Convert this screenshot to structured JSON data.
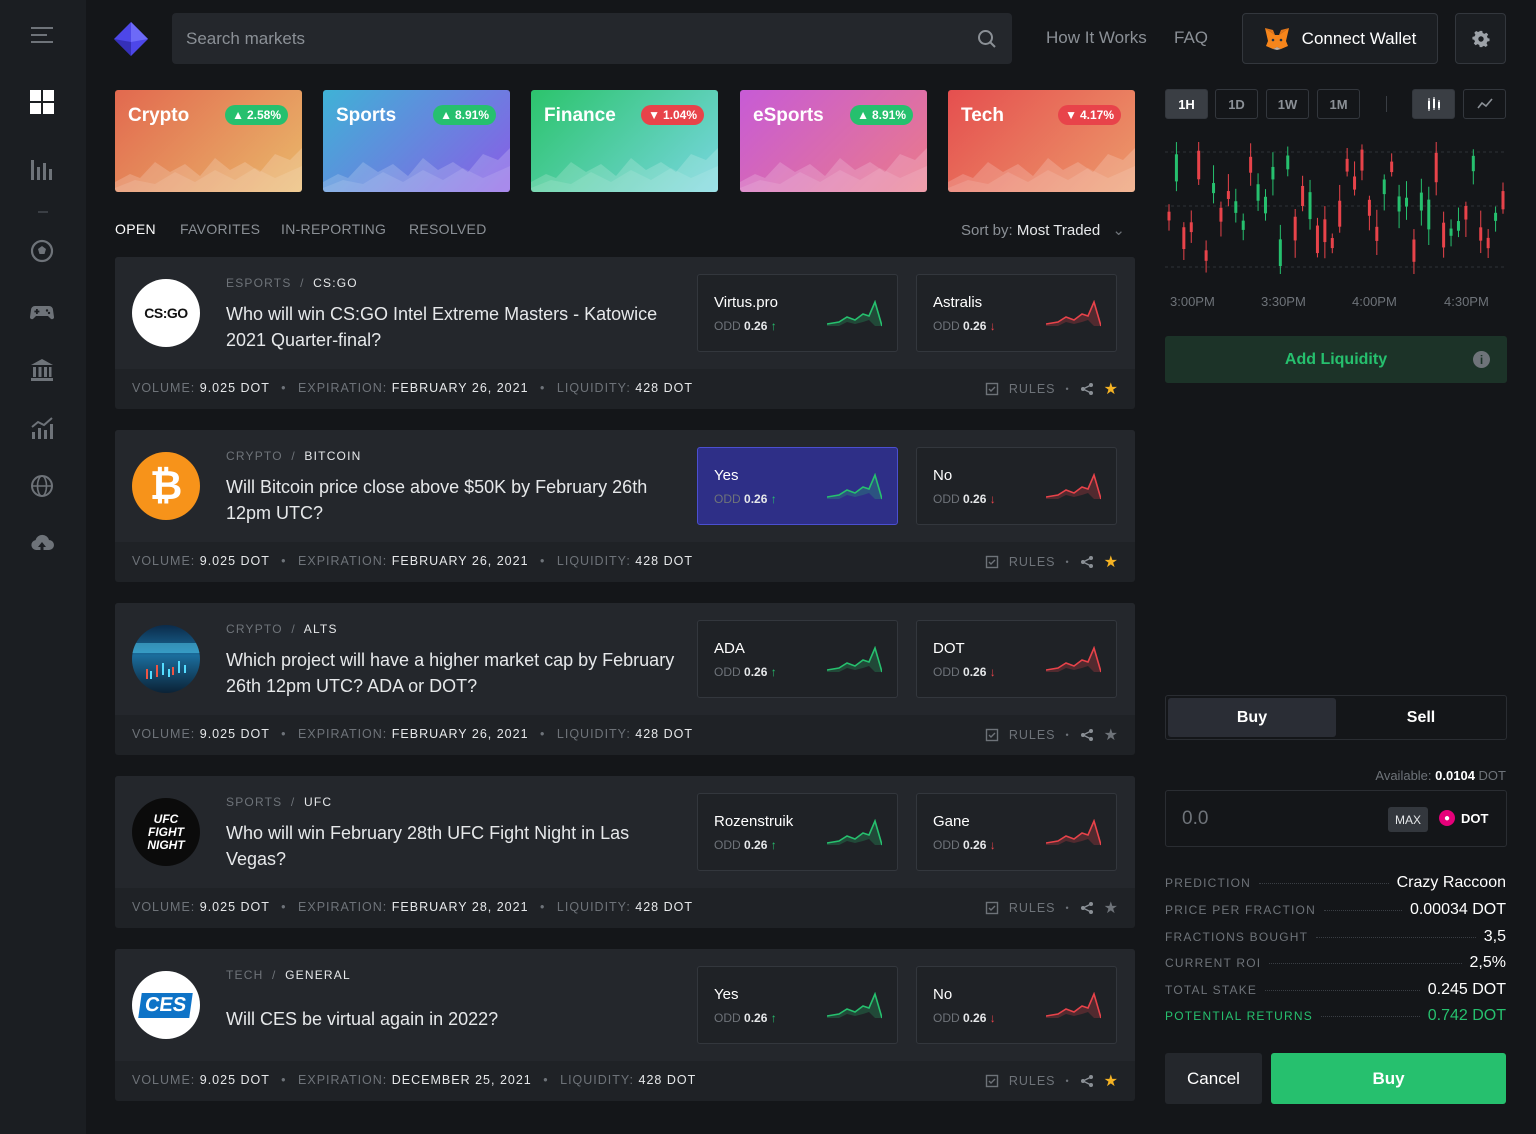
{
  "sidebar": {
    "items": [
      {
        "icon": "menu-icon"
      },
      {
        "icon": "dashboard-icon"
      },
      {
        "icon": "bar-chart-icon"
      },
      {
        "icon": "soccer-ball-icon"
      },
      {
        "icon": "gamepad-icon"
      },
      {
        "icon": "bank-icon"
      },
      {
        "icon": "trending-chart-icon"
      },
      {
        "icon": "globe-bitcoin-icon"
      },
      {
        "icon": "cloud-upload-icon"
      }
    ]
  },
  "header": {
    "search_placeholder": "Search markets",
    "how_it_works": "How It Works",
    "faq": "FAQ",
    "connect_wallet": "Connect Wallet"
  },
  "categories": [
    {
      "name": "Crypto",
      "change": "2.58%",
      "dir": "up",
      "colors": [
        "#e2694f",
        "#e9b86a"
      ]
    },
    {
      "name": "Sports",
      "change": "8.91%",
      "dir": "up",
      "colors": [
        "#3fb2d6",
        "#8a5ce6"
      ]
    },
    {
      "name": "Finance",
      "change": "1.04%",
      "dir": "down",
      "colors": [
        "#2cc46c",
        "#78d6e0"
      ]
    },
    {
      "name": "eSports",
      "change": "8.91%",
      "dir": "up",
      "colors": [
        "#c75bd6",
        "#ea7a8a"
      ]
    },
    {
      "name": "Tech",
      "change": "4.17%",
      "dir": "down",
      "colors": [
        "#e54f4f",
        "#ec9a6a"
      ]
    }
  ],
  "tabs": [
    "OPEN",
    "FAVORITES",
    "IN-REPORTING",
    "RESOLVED"
  ],
  "sort": {
    "label": "Sort by:",
    "value": "Most Traded"
  },
  "markets": [
    {
      "category": "ESPORTS",
      "subcategory": "CS:GO",
      "question": "Who will win CS:GO Intel Extreme Masters - Katowice 2021 Quarter-final?",
      "logo_text": "CS:GO",
      "options": [
        {
          "name": "Virtus.pro",
          "odd_label": "ODD",
          "odd": "0.26",
          "dir": "up",
          "selected": false
        },
        {
          "name": "Astralis",
          "odd_label": "ODD",
          "odd": "0.26",
          "dir": "down",
          "selected": false
        }
      ],
      "volume_label": "VOLUME:",
      "volume": "9.025 DOT",
      "expiration_label": "EXPIRATION:",
      "expiration": "FEBRUARY 26, 2021",
      "liquidity_label": "LIQUIDITY:",
      "liquidity": "428 DOT",
      "rules": "RULES",
      "favorite": true
    },
    {
      "category": "CRYPTO",
      "subcategory": "BITCOIN",
      "question": "Will Bitcoin price close above $50K by February 26th 12pm UTC?",
      "logo_text": "₿",
      "options": [
        {
          "name": "Yes",
          "odd_label": "ODD",
          "odd": "0.26",
          "dir": "up",
          "selected": true
        },
        {
          "name": "No",
          "odd_label": "ODD",
          "odd": "0.26",
          "dir": "down",
          "selected": false
        }
      ],
      "volume_label": "VOLUME:",
      "volume": "9.025 DOT",
      "expiration_label": "EXPIRATION:",
      "expiration": "FEBRUARY 26, 2021",
      "liquidity_label": "LIQUIDITY:",
      "liquidity": "428 DOT",
      "rules": "RULES",
      "favorite": true
    },
    {
      "category": "CRYPTO",
      "subcategory": "ALTS",
      "question": "Which project will have a higher market cap by February 26th 12pm UTC? ADA or DOT?",
      "logo_text": "",
      "options": [
        {
          "name": "ADA",
          "odd_label": "ODD",
          "odd": "0.26",
          "dir": "up",
          "selected": false
        },
        {
          "name": "DOT",
          "odd_label": "ODD",
          "odd": "0.26",
          "dir": "down",
          "selected": false
        }
      ],
      "volume_label": "VOLUME:",
      "volume": "9.025 DOT",
      "expiration_label": "EXPIRATION:",
      "expiration": "FEBRUARY 26, 2021",
      "liquidity_label": "LIQUIDITY:",
      "liquidity": "428 DOT",
      "rules": "RULES",
      "favorite": false
    },
    {
      "category": "SPORTS",
      "subcategory": "UFC",
      "question": "Who will win February 28th UFC Fight Night in Las Vegas?",
      "logo_text": "UFC FIGHT NIGHT",
      "options": [
        {
          "name": "Rozenstruik",
          "odd_label": "ODD",
          "odd": "0.26",
          "dir": "up",
          "selected": false
        },
        {
          "name": "Gane",
          "odd_label": "ODD",
          "odd": "0.26",
          "dir": "down",
          "selected": false
        }
      ],
      "volume_label": "VOLUME:",
      "volume": "9.025 DOT",
      "expiration_label": "EXPIRATION:",
      "expiration": "FEBRUARY 28, 2021",
      "liquidity_label": "LIQUIDITY:",
      "liquidity": "428 DOT",
      "rules": "RULES",
      "favorite": false
    },
    {
      "category": "TECH",
      "subcategory": "GENERAL",
      "question": "Will CES be virtual again in 2022?",
      "logo_text": "CES",
      "options": [
        {
          "name": "Yes",
          "odd_label": "ODD",
          "odd": "0.26",
          "dir": "up",
          "selected": false
        },
        {
          "name": "No",
          "odd_label": "ODD",
          "odd": "0.26",
          "dir": "down",
          "selected": false
        }
      ],
      "volume_label": "VOLUME:",
      "volume": "9.025 DOT",
      "expiration_label": "EXPIRATION:",
      "expiration": "DECEMBER 25, 2021",
      "liquidity_label": "LIQUIDITY:",
      "liquidity": "428 DOT",
      "rules": "RULES",
      "favorite": true
    }
  ],
  "panel": {
    "timeframes": [
      "1H",
      "1D",
      "1W",
      "1M"
    ],
    "active_timeframe": "1H",
    "chart_times": [
      "3:00PM",
      "3:30PM",
      "4:00PM",
      "4:30PM"
    ],
    "add_liquidity": "Add Liquidity",
    "buy_tab": "Buy",
    "sell_tab": "Sell",
    "available_label": "Available:",
    "available_value": "0.0104",
    "available_unit": "DOT",
    "amount_placeholder": "0.0",
    "max": "MAX",
    "currency": "DOT",
    "summary": [
      {
        "key": "PREDICTION",
        "value": "Crazy Raccoon"
      },
      {
        "key": "PRICE PER FRACTION",
        "value": "0.00034 DOT"
      },
      {
        "key": "FRACTIONS BOUGHT",
        "value": "3,5"
      },
      {
        "key": "CURRENT ROI",
        "value": "2,5%"
      },
      {
        "key": "TOTAL STAKE",
        "value": "0.245 DOT"
      },
      {
        "key": "POTENTIAL RETURNS",
        "value": "0.742 DOT"
      }
    ],
    "cancel": "Cancel",
    "buy": "Buy"
  },
  "colors": {
    "green": "#26c06e",
    "red": "#e8434a",
    "accent": "#4b4fd1"
  }
}
